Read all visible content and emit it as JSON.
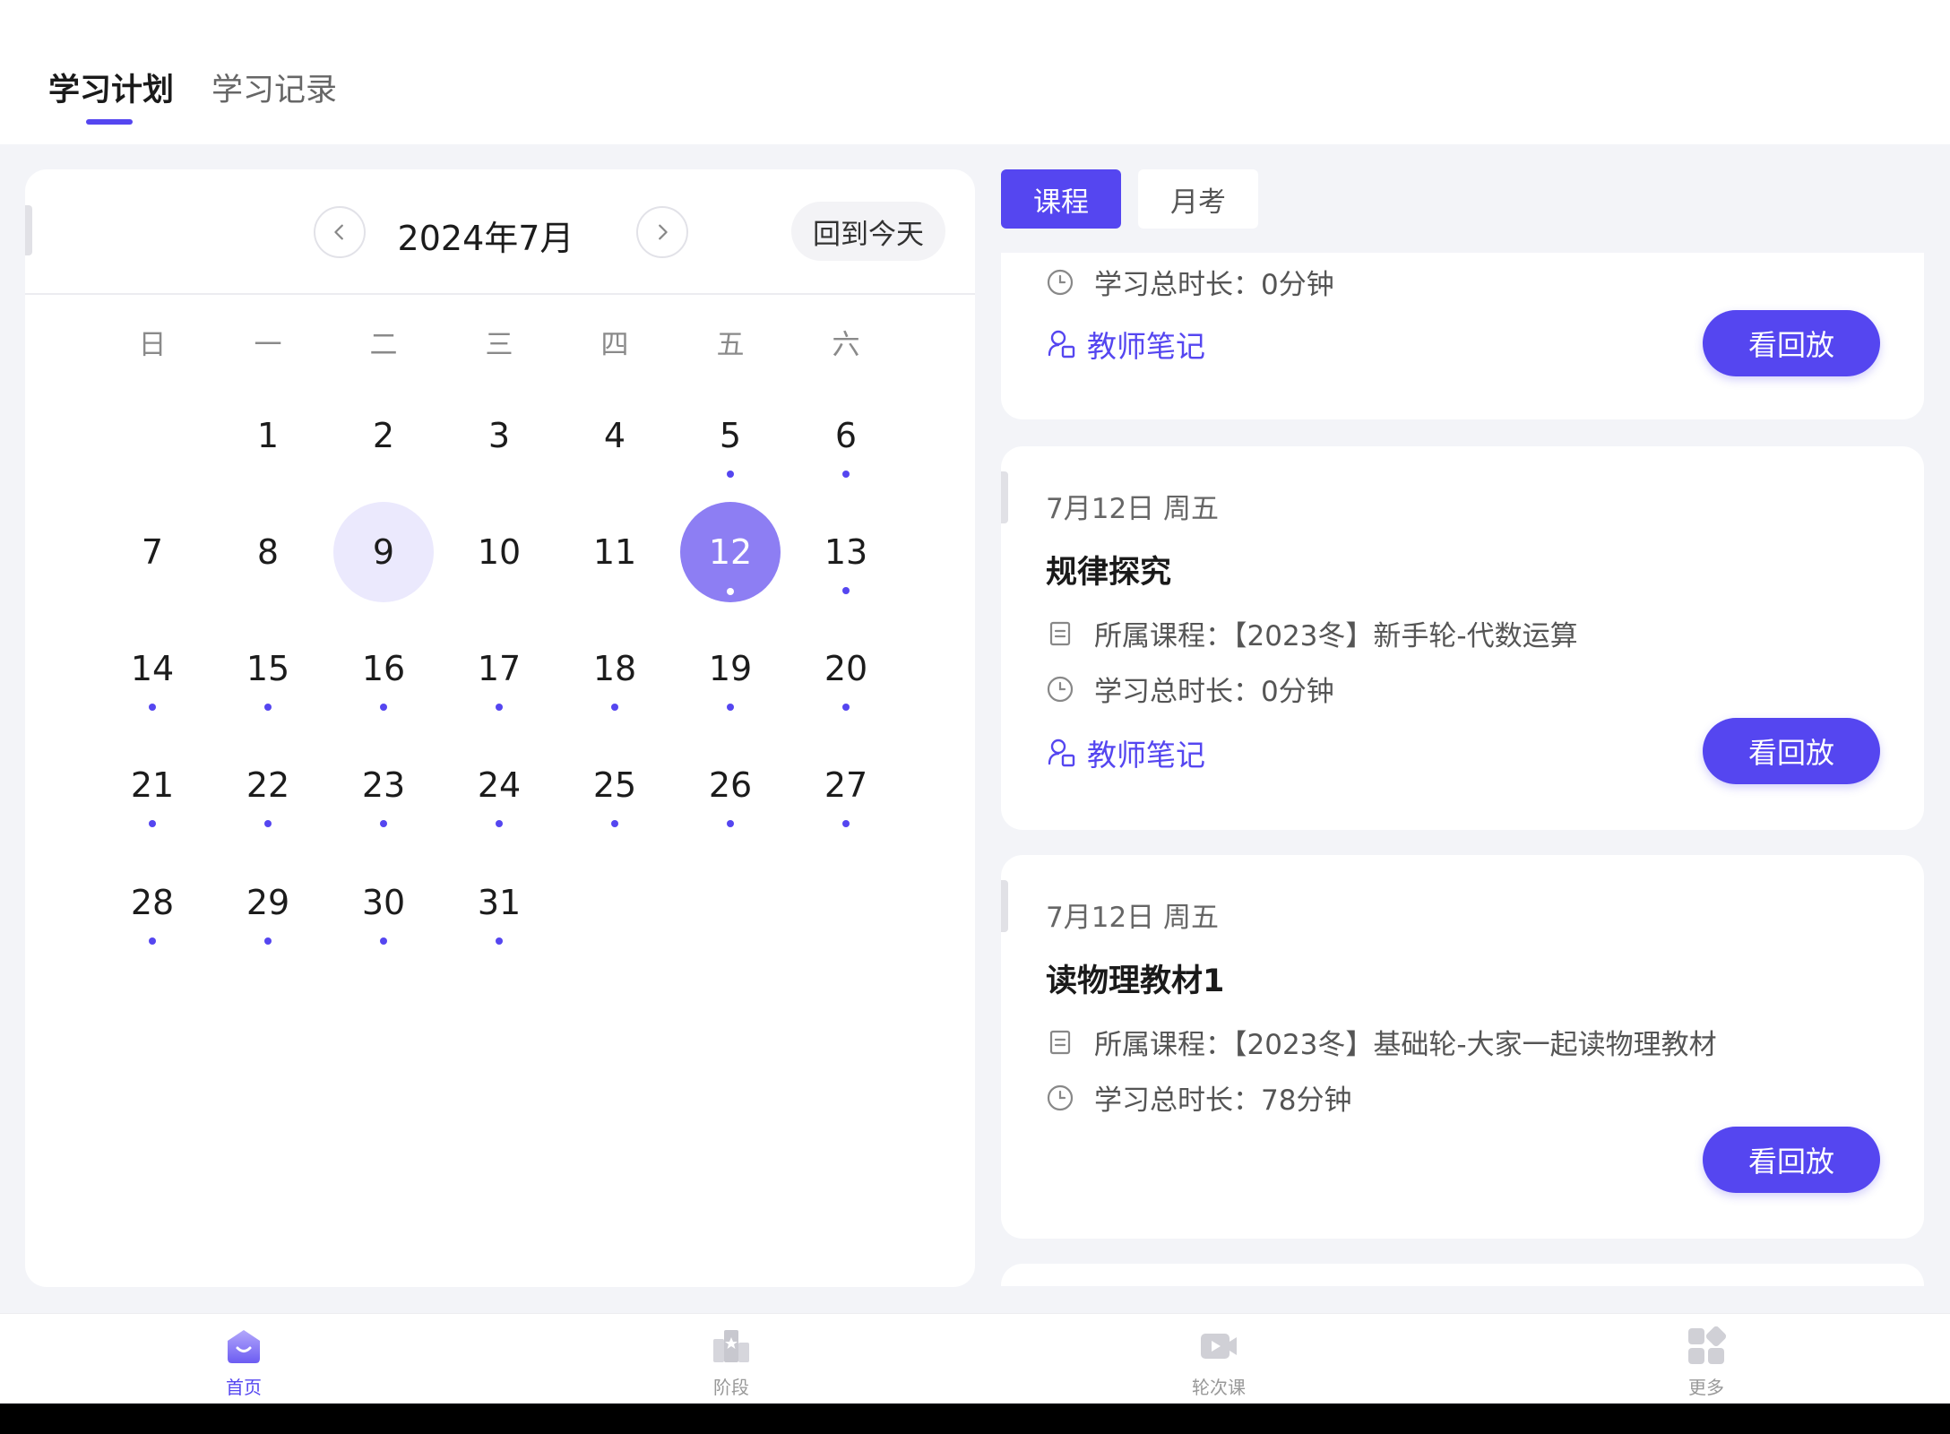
{
  "top_tabs": {
    "plan": "学习计划",
    "record": "学习记录"
  },
  "calendar": {
    "month_title": "2024年7月",
    "today_button": "回到今天",
    "weekdays": [
      "日",
      "一",
      "二",
      "三",
      "四",
      "五",
      "六"
    ],
    "days": [
      {
        "d": "1",
        "dot": false
      },
      {
        "d": "2",
        "dot": false
      },
      {
        "d": "3",
        "dot": false
      },
      {
        "d": "4",
        "dot": false
      },
      {
        "d": "5",
        "dot": true
      },
      {
        "d": "6",
        "dot": true
      },
      {
        "d": "7",
        "dot": false
      },
      {
        "d": "8",
        "dot": false
      },
      {
        "d": "9",
        "dot": false,
        "state": "today"
      },
      {
        "d": "10",
        "dot": false
      },
      {
        "d": "11",
        "dot": false
      },
      {
        "d": "12",
        "dot": true,
        "state": "selected"
      },
      {
        "d": "13",
        "dot": true
      },
      {
        "d": "14",
        "dot": true
      },
      {
        "d": "15",
        "dot": true
      },
      {
        "d": "16",
        "dot": true
      },
      {
        "d": "17",
        "dot": true
      },
      {
        "d": "18",
        "dot": true
      },
      {
        "d": "19",
        "dot": true
      },
      {
        "d": "20",
        "dot": true
      },
      {
        "d": "21",
        "dot": true
      },
      {
        "d": "22",
        "dot": true
      },
      {
        "d": "23",
        "dot": true
      },
      {
        "d": "24",
        "dot": true
      },
      {
        "d": "25",
        "dot": true
      },
      {
        "d": "26",
        "dot": true
      },
      {
        "d": "27",
        "dot": true
      },
      {
        "d": "28",
        "dot": true
      },
      {
        "d": "29",
        "dot": true
      },
      {
        "d": "30",
        "dot": true
      },
      {
        "d": "31",
        "dot": true
      }
    ]
  },
  "segment_tabs": {
    "course": "课程",
    "monthly_exam": "月考"
  },
  "cards": [
    {
      "duration": "学习总时长：0分钟",
      "notes_label": "教师笔记",
      "replay_label": "看回放"
    },
    {
      "date": "7月12日 周五",
      "title": "规律探究",
      "course": "所属课程：【2023冬】新手轮-代数运算",
      "duration": "学习总时长：0分钟",
      "notes_label": "教师笔记",
      "replay_label": "看回放"
    },
    {
      "date": "7月12日 周五",
      "title": "读物理教材1",
      "course": "所属课程：【2023冬】基础轮-大家一起读物理教材",
      "duration": "学习总时长：78分钟",
      "replay_label": "看回放"
    }
  ],
  "bottom_nav": [
    {
      "label": "首页",
      "icon": "home-icon",
      "active": true
    },
    {
      "label": "阶段",
      "icon": "stage-icon",
      "active": false
    },
    {
      "label": "轮次课",
      "icon": "video-icon",
      "active": false
    },
    {
      "label": "更多",
      "icon": "more-grid-icon",
      "active": false
    }
  ],
  "colors": {
    "accent": "#5546f0",
    "selected_day": "#8d7ef3",
    "today_day": "#ebe9fd"
  }
}
